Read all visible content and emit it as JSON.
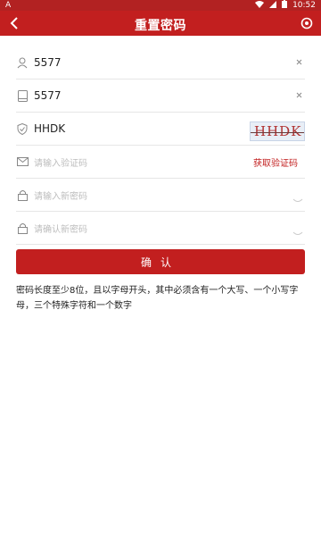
{
  "status": {
    "left_glyph": "A",
    "time": "10:52"
  },
  "appbar": {
    "title": "重置密码",
    "back_icon": "chevron-left-icon",
    "target_icon": "target-icon"
  },
  "form": {
    "account": {
      "value": "5577",
      "icon": "user-icon"
    },
    "mobile": {
      "value": "5577",
      "icon": "device-icon"
    },
    "captcha": {
      "value": "HHDK",
      "image_text": "HHDK",
      "icon": "shield-icon"
    },
    "sms": {
      "placeholder": "请输入验证码",
      "get_code_label": "获取验证码",
      "icon": "mail-icon"
    },
    "new_password": {
      "placeholder": "请输入新密码",
      "icon": "lock-icon"
    },
    "confirm_password": {
      "placeholder": "请确认新密码",
      "icon": "lock-icon"
    }
  },
  "confirm_button": {
    "label": "确认"
  },
  "hint": {
    "text": "密码长度至少8位，且以字母开头，其中必须含有一个大写、一个小写字母，三个特殊字符和一个数字"
  },
  "colors": {
    "primary": "#c21f1f",
    "statusbar": "#b22222",
    "divider": "#e6e6e6",
    "placeholder": "#bdbdbd"
  }
}
